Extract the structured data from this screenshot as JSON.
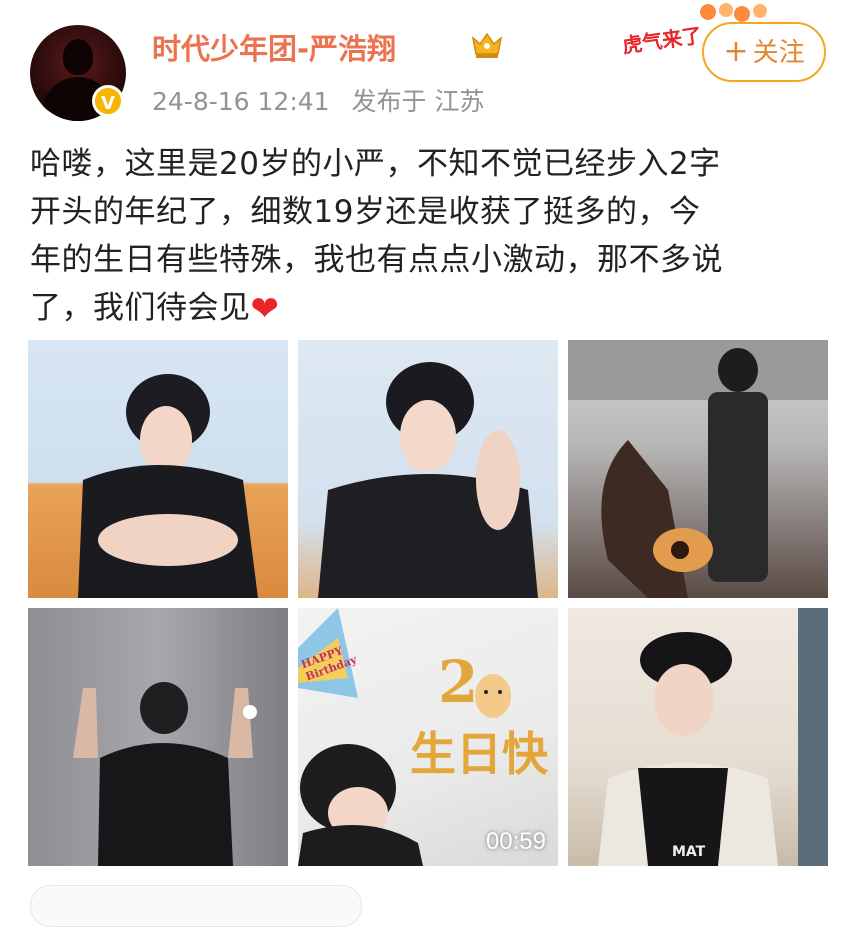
{
  "user": {
    "name": "时代少年团-严浩翔",
    "verified_badge": "V",
    "avatar_icon": "person-silhouette"
  },
  "meta": {
    "time": "24-8-16 12:41",
    "location": "发布于 江苏"
  },
  "follow": {
    "plus": "+",
    "label": "关注"
  },
  "decoration": {
    "text": "虎气来了"
  },
  "post": {
    "lines": [
      "哈喽，这里是20岁的小严，不知不觉已经步入2字",
      "开头的年纪了，细数19岁还是收获了挺多的，今",
      "年的生日有些特殊，我也有点点小激动，那不多说",
      "了，我们待会见"
    ],
    "emoji": "❤"
  },
  "media": {
    "video_duration": "00:59",
    "card_number": "2",
    "card_text": "生日快",
    "card_small": "HAPPY Birthday",
    "shirt_text": "MAT"
  },
  "colors": {
    "username": "#eb7350",
    "meta": "#939393",
    "follow_border": "#f5a623",
    "heart": "#e8262a"
  }
}
